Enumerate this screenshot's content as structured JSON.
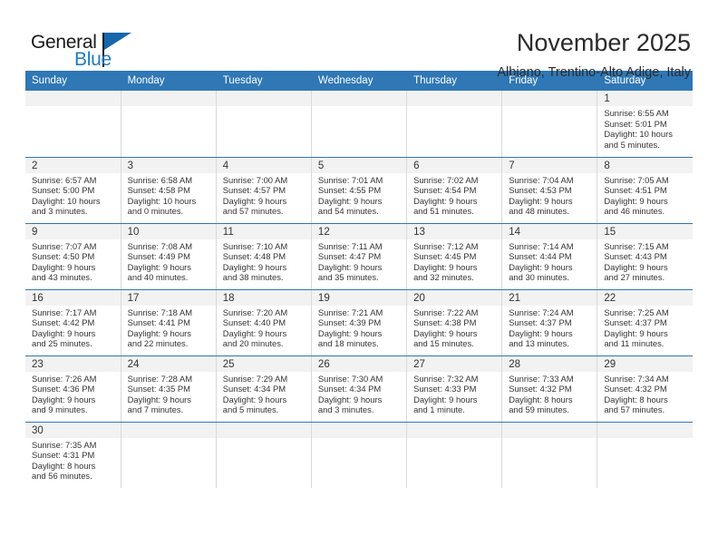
{
  "branding": {
    "name_part1": "General",
    "name_part2": "Blue",
    "flag_icon": "blue-triangle-flag-icon"
  },
  "header": {
    "title": "November 2025",
    "subtitle": "Albiano, Trentino-Alto Adige, Italy"
  },
  "colors": {
    "header_blue": "#2f77b5",
    "logo_blue": "#1e7bc4",
    "daynum_band": "#f2f2f2",
    "row_rule": "#2f77b5"
  },
  "weekdays": [
    "Sunday",
    "Monday",
    "Tuesday",
    "Wednesday",
    "Thursday",
    "Friday",
    "Saturday"
  ],
  "labels": {
    "sunrise_prefix": "Sunrise:",
    "sunset_prefix": "Sunset:",
    "daylight_prefix": "Daylight:"
  },
  "weeks": [
    [
      {
        "day": "",
        "blank": true
      },
      {
        "day": "",
        "blank": true
      },
      {
        "day": "",
        "blank": true
      },
      {
        "day": "",
        "blank": true
      },
      {
        "day": "",
        "blank": true
      },
      {
        "day": "",
        "blank": true
      },
      {
        "day": "1",
        "sunrise": "Sunrise: 6:55 AM",
        "sunset": "Sunset: 5:01 PM",
        "daylight1": "Daylight: 10 hours",
        "daylight2": "and 5 minutes."
      }
    ],
    [
      {
        "day": "2",
        "sunrise": "Sunrise: 6:57 AM",
        "sunset": "Sunset: 5:00 PM",
        "daylight1": "Daylight: 10 hours",
        "daylight2": "and 3 minutes."
      },
      {
        "day": "3",
        "sunrise": "Sunrise: 6:58 AM",
        "sunset": "Sunset: 4:58 PM",
        "daylight1": "Daylight: 10 hours",
        "daylight2": "and 0 minutes."
      },
      {
        "day": "4",
        "sunrise": "Sunrise: 7:00 AM",
        "sunset": "Sunset: 4:57 PM",
        "daylight1": "Daylight: 9 hours",
        "daylight2": "and 57 minutes."
      },
      {
        "day": "5",
        "sunrise": "Sunrise: 7:01 AM",
        "sunset": "Sunset: 4:55 PM",
        "daylight1": "Daylight: 9 hours",
        "daylight2": "and 54 minutes."
      },
      {
        "day": "6",
        "sunrise": "Sunrise: 7:02 AM",
        "sunset": "Sunset: 4:54 PM",
        "daylight1": "Daylight: 9 hours",
        "daylight2": "and 51 minutes."
      },
      {
        "day": "7",
        "sunrise": "Sunrise: 7:04 AM",
        "sunset": "Sunset: 4:53 PM",
        "daylight1": "Daylight: 9 hours",
        "daylight2": "and 48 minutes."
      },
      {
        "day": "8",
        "sunrise": "Sunrise: 7:05 AM",
        "sunset": "Sunset: 4:51 PM",
        "daylight1": "Daylight: 9 hours",
        "daylight2": "and 46 minutes."
      }
    ],
    [
      {
        "day": "9",
        "sunrise": "Sunrise: 7:07 AM",
        "sunset": "Sunset: 4:50 PM",
        "daylight1": "Daylight: 9 hours",
        "daylight2": "and 43 minutes."
      },
      {
        "day": "10",
        "sunrise": "Sunrise: 7:08 AM",
        "sunset": "Sunset: 4:49 PM",
        "daylight1": "Daylight: 9 hours",
        "daylight2": "and 40 minutes."
      },
      {
        "day": "11",
        "sunrise": "Sunrise: 7:10 AM",
        "sunset": "Sunset: 4:48 PM",
        "daylight1": "Daylight: 9 hours",
        "daylight2": "and 38 minutes."
      },
      {
        "day": "12",
        "sunrise": "Sunrise: 7:11 AM",
        "sunset": "Sunset: 4:47 PM",
        "daylight1": "Daylight: 9 hours",
        "daylight2": "and 35 minutes."
      },
      {
        "day": "13",
        "sunrise": "Sunrise: 7:12 AM",
        "sunset": "Sunset: 4:45 PM",
        "daylight1": "Daylight: 9 hours",
        "daylight2": "and 32 minutes."
      },
      {
        "day": "14",
        "sunrise": "Sunrise: 7:14 AM",
        "sunset": "Sunset: 4:44 PM",
        "daylight1": "Daylight: 9 hours",
        "daylight2": "and 30 minutes."
      },
      {
        "day": "15",
        "sunrise": "Sunrise: 7:15 AM",
        "sunset": "Sunset: 4:43 PM",
        "daylight1": "Daylight: 9 hours",
        "daylight2": "and 27 minutes."
      }
    ],
    [
      {
        "day": "16",
        "sunrise": "Sunrise: 7:17 AM",
        "sunset": "Sunset: 4:42 PM",
        "daylight1": "Daylight: 9 hours",
        "daylight2": "and 25 minutes."
      },
      {
        "day": "17",
        "sunrise": "Sunrise: 7:18 AM",
        "sunset": "Sunset: 4:41 PM",
        "daylight1": "Daylight: 9 hours",
        "daylight2": "and 22 minutes."
      },
      {
        "day": "18",
        "sunrise": "Sunrise: 7:20 AM",
        "sunset": "Sunset: 4:40 PM",
        "daylight1": "Daylight: 9 hours",
        "daylight2": "and 20 minutes."
      },
      {
        "day": "19",
        "sunrise": "Sunrise: 7:21 AM",
        "sunset": "Sunset: 4:39 PM",
        "daylight1": "Daylight: 9 hours",
        "daylight2": "and 18 minutes."
      },
      {
        "day": "20",
        "sunrise": "Sunrise: 7:22 AM",
        "sunset": "Sunset: 4:38 PM",
        "daylight1": "Daylight: 9 hours",
        "daylight2": "and 15 minutes."
      },
      {
        "day": "21",
        "sunrise": "Sunrise: 7:24 AM",
        "sunset": "Sunset: 4:37 PM",
        "daylight1": "Daylight: 9 hours",
        "daylight2": "and 13 minutes."
      },
      {
        "day": "22",
        "sunrise": "Sunrise: 7:25 AM",
        "sunset": "Sunset: 4:37 PM",
        "daylight1": "Daylight: 9 hours",
        "daylight2": "and 11 minutes."
      }
    ],
    [
      {
        "day": "23",
        "sunrise": "Sunrise: 7:26 AM",
        "sunset": "Sunset: 4:36 PM",
        "daylight1": "Daylight: 9 hours",
        "daylight2": "and 9 minutes."
      },
      {
        "day": "24",
        "sunrise": "Sunrise: 7:28 AM",
        "sunset": "Sunset: 4:35 PM",
        "daylight1": "Daylight: 9 hours",
        "daylight2": "and 7 minutes."
      },
      {
        "day": "25",
        "sunrise": "Sunrise: 7:29 AM",
        "sunset": "Sunset: 4:34 PM",
        "daylight1": "Daylight: 9 hours",
        "daylight2": "and 5 minutes."
      },
      {
        "day": "26",
        "sunrise": "Sunrise: 7:30 AM",
        "sunset": "Sunset: 4:34 PM",
        "daylight1": "Daylight: 9 hours",
        "daylight2": "and 3 minutes."
      },
      {
        "day": "27",
        "sunrise": "Sunrise: 7:32 AM",
        "sunset": "Sunset: 4:33 PM",
        "daylight1": "Daylight: 9 hours",
        "daylight2": "and 1 minute."
      },
      {
        "day": "28",
        "sunrise": "Sunrise: 7:33 AM",
        "sunset": "Sunset: 4:32 PM",
        "daylight1": "Daylight: 8 hours",
        "daylight2": "and 59 minutes."
      },
      {
        "day": "29",
        "sunrise": "Sunrise: 7:34 AM",
        "sunset": "Sunset: 4:32 PM",
        "daylight1": "Daylight: 8 hours",
        "daylight2": "and 57 minutes."
      }
    ],
    [
      {
        "day": "30",
        "sunrise": "Sunrise: 7:35 AM",
        "sunset": "Sunset: 4:31 PM",
        "daylight1": "Daylight: 8 hours",
        "daylight2": "and 56 minutes."
      },
      {
        "day": "",
        "blank": true
      },
      {
        "day": "",
        "blank": true
      },
      {
        "day": "",
        "blank": true
      },
      {
        "day": "",
        "blank": true
      },
      {
        "day": "",
        "blank": true
      },
      {
        "day": "",
        "blank": true
      }
    ]
  ]
}
